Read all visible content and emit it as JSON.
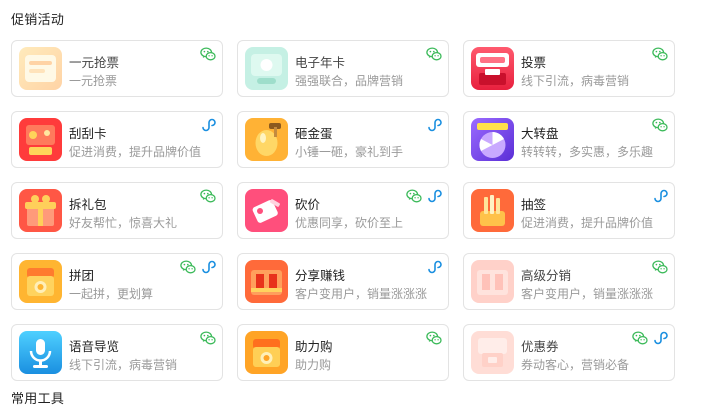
{
  "section_title": "促销活动",
  "next_section_title": "常用工具",
  "colors": {
    "wechat": "#3cba5a",
    "miniapp": "#1a8fe0"
  },
  "cards": [
    {
      "title": "一元抢票",
      "desc": "一元抢票",
      "icon": "ticket-icon",
      "dim": true,
      "badges": [
        "wechat-icon"
      ]
    },
    {
      "title": "电子年卡",
      "desc": "强强联合，品牌营销",
      "icon": "annual-card-icon",
      "dim": true,
      "badges": [
        "wechat-icon"
      ]
    },
    {
      "title": "投票",
      "desc": "线下引流，病毒营销",
      "icon": "vote-icon",
      "dim": false,
      "badges": [
        "wechat-icon"
      ]
    },
    {
      "title": "刮刮卡",
      "desc": "促进消费，提升品牌价值",
      "icon": "scratch-card-icon",
      "dim": false,
      "badges": [
        "miniapp-icon"
      ]
    },
    {
      "title": "砸金蛋",
      "desc": "小锤一砸，豪礼到手",
      "icon": "golden-egg-icon",
      "dim": false,
      "badges": [
        "miniapp-icon"
      ]
    },
    {
      "title": "大转盘",
      "desc": "转转转，多实惠，多乐趣",
      "icon": "wheel-icon",
      "dim": false,
      "badges": [
        "wechat-icon"
      ]
    },
    {
      "title": "拆礼包",
      "desc": "好友帮忙，惊喜大礼",
      "icon": "gift-icon",
      "dim": false,
      "badges": [
        "wechat-icon"
      ]
    },
    {
      "title": "砍价",
      "desc": "优惠同享，砍价至上",
      "icon": "bargain-icon",
      "dim": false,
      "badges": [
        "wechat-icon",
        "miniapp-icon"
      ]
    },
    {
      "title": "抽签",
      "desc": "促进消费，提升品牌价值",
      "icon": "lottery-icon",
      "dim": false,
      "badges": [
        "miniapp-icon"
      ]
    },
    {
      "title": "拼团",
      "desc": "一起拼，更划算",
      "icon": "group-buy-icon",
      "dim": false,
      "badges": [
        "wechat-icon",
        "miniapp-icon"
      ]
    },
    {
      "title": "分享赚钱",
      "desc": "客户变用户，销量涨涨涨",
      "icon": "share-earn-icon",
      "dim": false,
      "badges": [
        "miniapp-icon"
      ]
    },
    {
      "title": "高级分销",
      "desc": "客户变用户，销量涨涨涨",
      "icon": "distribution-icon",
      "dim": true,
      "badges": [
        "wechat-icon"
      ]
    },
    {
      "title": "语音导览",
      "desc": "线下引流，病毒营销",
      "icon": "audio-guide-icon",
      "dim": false,
      "badges": [
        "wechat-icon"
      ]
    },
    {
      "title": "助力购",
      "desc": "助力购",
      "icon": "assist-buy-icon",
      "dim": false,
      "badges": [
        "wechat-icon"
      ]
    },
    {
      "title": "优惠券",
      "desc": "券动客心，营销必备",
      "icon": "coupon-icon",
      "dim": true,
      "badges": [
        "wechat-icon",
        "miniapp-icon"
      ]
    }
  ]
}
